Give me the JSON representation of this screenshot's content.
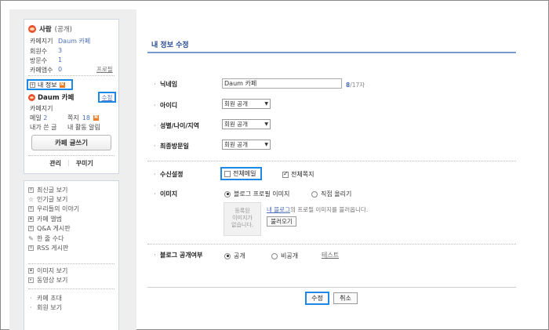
{
  "sidebar": {
    "cafe_name": "사람",
    "cafe_visibility": "(공개)",
    "info": [
      {
        "key": "카페지기",
        "value": "Daum 카페"
      },
      {
        "key": "회원수",
        "value": "3"
      },
      {
        "key": "방문수",
        "value": "1"
      },
      {
        "key": "카페앱수",
        "value": "0"
      }
    ],
    "profile_link": "프로필",
    "my_info_label": "내 정보",
    "new_badge": "N",
    "user_name": "Daum 카페",
    "edit_label": "수정",
    "role": "카페지기",
    "mail_label": "메일",
    "mail_count": "2",
    "note_label": "쪽지",
    "note_count": "18",
    "my_posts": "내가 쓴 글",
    "my_alerts": "내 활동 알림",
    "write_button": "카페 글쓰기",
    "manage": "관리",
    "decorate": "꾸미기",
    "menu_group1": [
      "최신글 보기",
      "인기글 보기",
      "우리들의 이야기",
      "카페 앨범",
      "Q&A 게시판",
      "한 줄 수다",
      "RSS 게시판"
    ],
    "menu_group2": [
      "이미지 보기",
      "동영상 보기"
    ],
    "menu_group3": [
      "카페 초대",
      "회원 보기"
    ]
  },
  "main": {
    "page_title": "내 정보 수정",
    "nickname_label": "닉네임",
    "nickname_value": "Daum 카페",
    "nickname_count": "8",
    "nickname_max": "/17자",
    "id_label": "아이디",
    "id_select": "회원 공개",
    "profile_label": "성별/나이/지역",
    "profile_select": "회원 공개",
    "lastvisit_label": "최종방문일",
    "lastvisit_select": "회원 공개",
    "receive_label": "수신설정",
    "all_mail": "전체메일",
    "all_note": "전체쪽지",
    "image_label": "이미지",
    "blog_profile_image": "블로그 프로필 이미지",
    "upload_direct": "직접 올리기",
    "no_image_lines": [
      "등록된",
      "이미지가",
      "없습니다."
    ],
    "blog_link": "내 블로그",
    "img_note_rest": "의 프로필 이미지를 불러옵니다.",
    "load_button": "불러오기",
    "blog_public_label": "블로그 공개여부",
    "public": "공개",
    "private": "비공개",
    "test_link": "테스트",
    "save_button": "수정",
    "cancel_button": "취소"
  },
  "colors": {
    "highlight": "#1e88e5",
    "title": "#2a4c93",
    "accent_line": "#7c9ad2",
    "badge": "#f07c2a"
  }
}
